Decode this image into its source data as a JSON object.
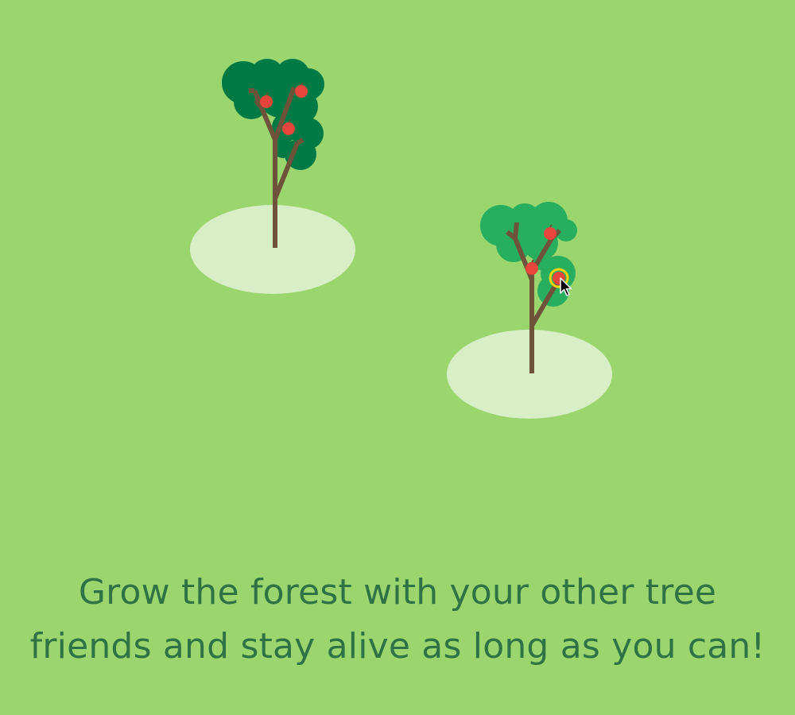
{
  "colors": {
    "grass": "#9bd56d",
    "tree_shadow": "#d8eec7",
    "foliage_dark": "#007a44",
    "foliage_light": "#27ae5e",
    "trunk": "#6e5239",
    "apple": "#e8453c",
    "apple_highlight": "#ffd400",
    "message_text": "#2e7245"
  },
  "trees": [
    {
      "name": "tree-dark",
      "foliage": "dark",
      "apples": 3
    },
    {
      "name": "tree-light",
      "foliage": "light",
      "apples": 3
    }
  ],
  "cursor": {
    "icon": "arrow-pointer-icon"
  },
  "message": {
    "line1": "Grow the forest with your other tree",
    "line2": "friends and stay alive as long as you can!"
  }
}
